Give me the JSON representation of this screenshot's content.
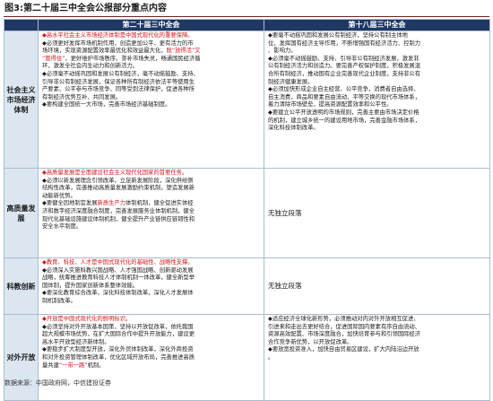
{
  "title": "图3:第二十届三中全会公报部分重点内容",
  "headers": {
    "category": "",
    "col20": "第二十届三中全会",
    "col18": "第十八届三中全会"
  },
  "rows": [
    {
      "category": "社会主义市场经济体制",
      "col20": [
        {
          "text": "◆高水平社会主义市场经济体制是中国式现代化的重要保障。",
          "color": "red"
        },
        {
          "text": "◆必须更好发挥市场机制作用，创造更加公平、更有活力的市"
        },
        {
          "text": "场环境，实现资源配置效率最优化和效益最大化，既“放得活”又",
          "mixed": [
            [
              "场环境，实现资源配置效率最优化和效益最大化，",
              ""
            ],
            [
              "既“放得活”又",
              "red"
            ]
          ]
        },
        {
          "text": "“管得住”，更好维护市场秩序、弥补市场失灵，畅通国民经济循",
          "mixed": [
            [
              "“管得住”",
              "red"
            ],
            [
              "，更好维护市场秩序、弥补市场失灵，畅通国民经济循",
              ""
            ]
          ]
        },
        {
          "text": "环，激发全社会内生动力和创新活力。"
        },
        {
          "text": "◆必须毫不动摇巩固和发展公有制经济，毫不动摇鼓励、支持、"
        },
        {
          "text": "引导非公有制经济发展，保证各种所有制经济依法平等使用生"
        },
        {
          "text": "产要素、公平参与市场竞争、同等受到法律保护，促进各种所"
        },
        {
          "text": "有制经济优势互补、共同发展。"
        },
        {
          "text": "◆要构建全国统一大市场，完善市场经济基础制度。"
        }
      ],
      "col18": [
        {
          "text": "◆要毫不动摇巩固和发展公有制经济，坚持公有制主体地"
        },
        {
          "text": "位，发挥国有经济主导作用，不断增强国有经济活力、控制力"
        },
        {
          "text": "、影响力。"
        },
        {
          "text": "◆必须毫不动摇鼓励、支持、引导非公有制经济发展，激发非"
        },
        {
          "text": "公有制经济活力和创造力。要完善产权保护制度，积极发展混"
        },
        {
          "text": "合所有制经济，推动国有企业完善现代企业制度，支持非公有"
        },
        {
          "text": "制经济健康发展。"
        },
        {
          "text": "◆必须加快形成企业自主经营、公平竞争，消费者自由选择、"
        },
        {
          "text": "自主消费，商品和要素自由流动、平等交换的现代市场体系，"
        },
        {
          "text": "着力清除市场壁垒，提高资源配置效率和公平性。"
        },
        {
          "text": "◆要建立公平开放透明的市场规则，完善主要由市场决定价格"
        },
        {
          "text": "的机制，建立城乡统一的建设用地市场，完善金融市场体系，"
        },
        {
          "text": "深化科技体制改革。"
        }
      ],
      "col18_center": false
    },
    {
      "category": "高质量发展",
      "col20": [
        {
          "text": "◆高质量发展是全面建设社会主义现代化国家的首要任务。",
          "color": "red"
        },
        {
          "text": "◆必须以新发展理念引领改革，立足新发展阶段，深化供给侧"
        },
        {
          "text": "结构性改革，完善推动高质量发展激励约束机制，塑造发展新"
        },
        {
          "text": "动能新优势。"
        },
        {
          "text": "◆要健全因地制宜发展新质生产力体制机制，健全促进实体经",
          "mixed": [
            [
              "◆要健全因地制宜发展",
              ""
            ],
            [
              "新质生产力",
              "red"
            ],
            [
              "体制机制，健全促进实体经",
              ""
            ]
          ]
        },
        {
          "text": "济和数字经济深度融合制度，完善发展服务业体制机制，健全"
        },
        {
          "text": "现代化基础设施建设体制机制，健全提升产业链供应链韧性和"
        },
        {
          "text": "安全水平制度。"
        }
      ],
      "col18": [
        {
          "text": "无独立段落"
        }
      ],
      "col18_center": true
    },
    {
      "category": "科教创新",
      "col20": [
        {
          "text": "◆教育、科技、人才是中国式现代化的基础性、战略性支撑。",
          "color": "red"
        },
        {
          "text": "◆必须深入实施科教兴国战略、人才强国战略、创新驱动发展"
        },
        {
          "text": "战略，统筹推进教育科技人才体制机制一体改革，健全新型举"
        },
        {
          "text": "国体制，提升国家创新体系整体效能。"
        },
        {
          "text": "◆要深化教育综合改革，深化科技体制改革，深化人才发展体"
        },
        {
          "text": "制机制改革。"
        }
      ],
      "col18": [
        {
          "text": "无独立段落"
        }
      ],
      "col18_center": true
    },
    {
      "category": "对外开放",
      "col20": [
        {
          "text": "◆开放是中国式现代化的鲜明标识。",
          "color": "red"
        },
        {
          "text": "◆必须坚持对外开放基本国策，坚持以开放促改革，依托我国"
        },
        {
          "text": "超大规模市场优势，在扩大国际合作中提升开放能力，建设更"
        },
        {
          "text": "高水平开放型经济新体制。"
        },
        {
          "text": "◆要稳步扩大制度型开放，深化外贸体制改革，深化外商投资"
        },
        {
          "text": "和对外投资管理体制改革，优化区域开放布局，完善推进高质"
        },
        {
          "text": "量共建“一带一路”机制。",
          "mixed": [
            [
              "量共建",
              ""
            ],
            [
              "“一带一路”",
              "red"
            ],
            [
              "机制。",
              ""
            ]
          ]
        }
      ],
      "col18": [
        {
          "text": "◆适应经济全球化新形势，必须推动对内对外开放相互促进、"
        },
        {
          "text": "引进来和走出去更好结合，促进国际国内要素有序自由流动、"
        },
        {
          "text": "资源高效配置、市场深度融合，加快培育参与和引领国际经济"
        },
        {
          "text": "合作竞争新优势，以开放促改革。"
        },
        {
          "text": "◆要放宽投资准入，加快自由贸易区建设，扩大内陆沿边开放"
        },
        {
          "text": "。"
        }
      ],
      "col18_center": false
    }
  ],
  "source": "数据来源：中国政府网，中信建投证券",
  "colors": {
    "header_bg": "#1f3864",
    "category_bg": "#dce6f1",
    "highlight": "#d2141b",
    "border": "#a9bccf"
  }
}
